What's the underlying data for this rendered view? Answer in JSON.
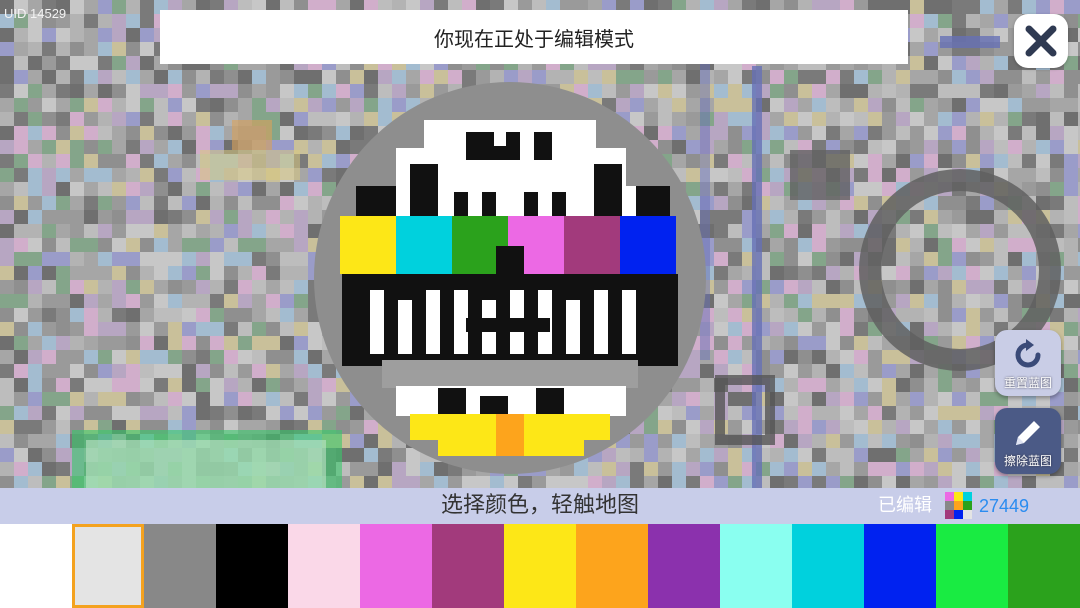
{
  "header": {
    "uid": "UID 14529",
    "mode_text": "你现在正处于编辑模式"
  },
  "icons": {
    "close": "close-x-icon",
    "reset": "rotate-arrow-icon",
    "erase": "pencil-icon",
    "edited": "pixel-grid-icon"
  },
  "side": {
    "reset_label": "重置蓝图",
    "erase_label": "擦除蓝图"
  },
  "bottom": {
    "hint": "选择颜色，轻触地图",
    "edited_label": "已编辑",
    "edited_count": "27449"
  },
  "palette": {
    "selected_index": 1,
    "colors": [
      "#ffffff",
      "#e4e4e4",
      "#888888",
      "#000000",
      "#fad8e8",
      "#ec69e4",
      "#a23a7c",
      "#fde717",
      "#fda41c",
      "#8b31ad",
      "#8afff0",
      "#00d1dd",
      "#0022f0",
      "#19eb42",
      "#2ba21c"
    ]
  },
  "blueprint": {
    "color_bars": [
      "#fde717",
      "#00d1dd",
      "#2ba21c",
      "#ec69e4",
      "#a23a7c",
      "#0022f0"
    ],
    "accent_colors": [
      "#fde717",
      "#fda41c"
    ]
  }
}
